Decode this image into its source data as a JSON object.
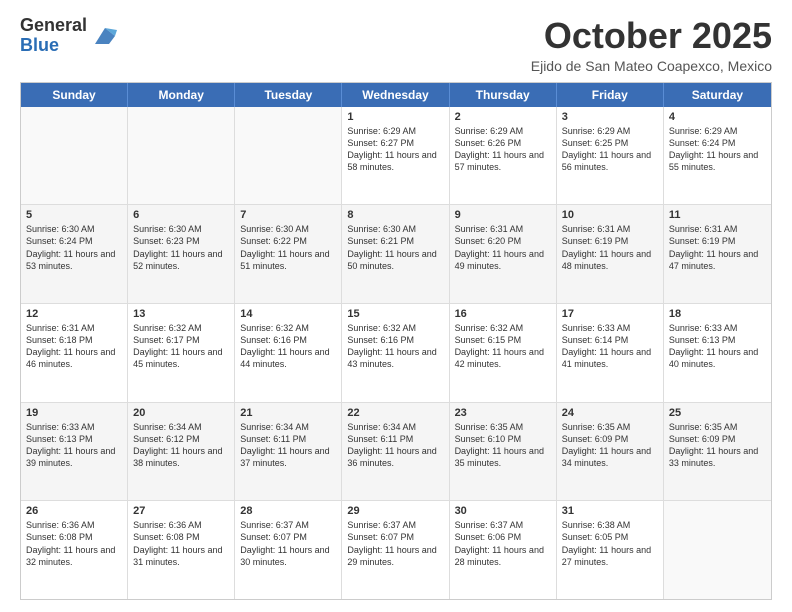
{
  "header": {
    "logo_line1": "General",
    "logo_line2": "Blue",
    "month_title": "October 2025",
    "location": "Ejido de San Mateo Coapexco, Mexico"
  },
  "days_of_week": [
    "Sunday",
    "Monday",
    "Tuesday",
    "Wednesday",
    "Thursday",
    "Friday",
    "Saturday"
  ],
  "weeks": [
    [
      {
        "day": "",
        "info": ""
      },
      {
        "day": "",
        "info": ""
      },
      {
        "day": "",
        "info": ""
      },
      {
        "day": "1",
        "info": "Sunrise: 6:29 AM\nSunset: 6:27 PM\nDaylight: 11 hours and 58 minutes."
      },
      {
        "day": "2",
        "info": "Sunrise: 6:29 AM\nSunset: 6:26 PM\nDaylight: 11 hours and 57 minutes."
      },
      {
        "day": "3",
        "info": "Sunrise: 6:29 AM\nSunset: 6:25 PM\nDaylight: 11 hours and 56 minutes."
      },
      {
        "day": "4",
        "info": "Sunrise: 6:29 AM\nSunset: 6:24 PM\nDaylight: 11 hours and 55 minutes."
      }
    ],
    [
      {
        "day": "5",
        "info": "Sunrise: 6:30 AM\nSunset: 6:24 PM\nDaylight: 11 hours and 53 minutes."
      },
      {
        "day": "6",
        "info": "Sunrise: 6:30 AM\nSunset: 6:23 PM\nDaylight: 11 hours and 52 minutes."
      },
      {
        "day": "7",
        "info": "Sunrise: 6:30 AM\nSunset: 6:22 PM\nDaylight: 11 hours and 51 minutes."
      },
      {
        "day": "8",
        "info": "Sunrise: 6:30 AM\nSunset: 6:21 PM\nDaylight: 11 hours and 50 minutes."
      },
      {
        "day": "9",
        "info": "Sunrise: 6:31 AM\nSunset: 6:20 PM\nDaylight: 11 hours and 49 minutes."
      },
      {
        "day": "10",
        "info": "Sunrise: 6:31 AM\nSunset: 6:19 PM\nDaylight: 11 hours and 48 minutes."
      },
      {
        "day": "11",
        "info": "Sunrise: 6:31 AM\nSunset: 6:19 PM\nDaylight: 11 hours and 47 minutes."
      }
    ],
    [
      {
        "day": "12",
        "info": "Sunrise: 6:31 AM\nSunset: 6:18 PM\nDaylight: 11 hours and 46 minutes."
      },
      {
        "day": "13",
        "info": "Sunrise: 6:32 AM\nSunset: 6:17 PM\nDaylight: 11 hours and 45 minutes."
      },
      {
        "day": "14",
        "info": "Sunrise: 6:32 AM\nSunset: 6:16 PM\nDaylight: 11 hours and 44 minutes."
      },
      {
        "day": "15",
        "info": "Sunrise: 6:32 AM\nSunset: 6:16 PM\nDaylight: 11 hours and 43 minutes."
      },
      {
        "day": "16",
        "info": "Sunrise: 6:32 AM\nSunset: 6:15 PM\nDaylight: 11 hours and 42 minutes."
      },
      {
        "day": "17",
        "info": "Sunrise: 6:33 AM\nSunset: 6:14 PM\nDaylight: 11 hours and 41 minutes."
      },
      {
        "day": "18",
        "info": "Sunrise: 6:33 AM\nSunset: 6:13 PM\nDaylight: 11 hours and 40 minutes."
      }
    ],
    [
      {
        "day": "19",
        "info": "Sunrise: 6:33 AM\nSunset: 6:13 PM\nDaylight: 11 hours and 39 minutes."
      },
      {
        "day": "20",
        "info": "Sunrise: 6:34 AM\nSunset: 6:12 PM\nDaylight: 11 hours and 38 minutes."
      },
      {
        "day": "21",
        "info": "Sunrise: 6:34 AM\nSunset: 6:11 PM\nDaylight: 11 hours and 37 minutes."
      },
      {
        "day": "22",
        "info": "Sunrise: 6:34 AM\nSunset: 6:11 PM\nDaylight: 11 hours and 36 minutes."
      },
      {
        "day": "23",
        "info": "Sunrise: 6:35 AM\nSunset: 6:10 PM\nDaylight: 11 hours and 35 minutes."
      },
      {
        "day": "24",
        "info": "Sunrise: 6:35 AM\nSunset: 6:09 PM\nDaylight: 11 hours and 34 minutes."
      },
      {
        "day": "25",
        "info": "Sunrise: 6:35 AM\nSunset: 6:09 PM\nDaylight: 11 hours and 33 minutes."
      }
    ],
    [
      {
        "day": "26",
        "info": "Sunrise: 6:36 AM\nSunset: 6:08 PM\nDaylight: 11 hours and 32 minutes."
      },
      {
        "day": "27",
        "info": "Sunrise: 6:36 AM\nSunset: 6:08 PM\nDaylight: 11 hours and 31 minutes."
      },
      {
        "day": "28",
        "info": "Sunrise: 6:37 AM\nSunset: 6:07 PM\nDaylight: 11 hours and 30 minutes."
      },
      {
        "day": "29",
        "info": "Sunrise: 6:37 AM\nSunset: 6:07 PM\nDaylight: 11 hours and 29 minutes."
      },
      {
        "day": "30",
        "info": "Sunrise: 6:37 AM\nSunset: 6:06 PM\nDaylight: 11 hours and 28 minutes."
      },
      {
        "day": "31",
        "info": "Sunrise: 6:38 AM\nSunset: 6:05 PM\nDaylight: 11 hours and 27 minutes."
      },
      {
        "day": "",
        "info": ""
      }
    ]
  ]
}
